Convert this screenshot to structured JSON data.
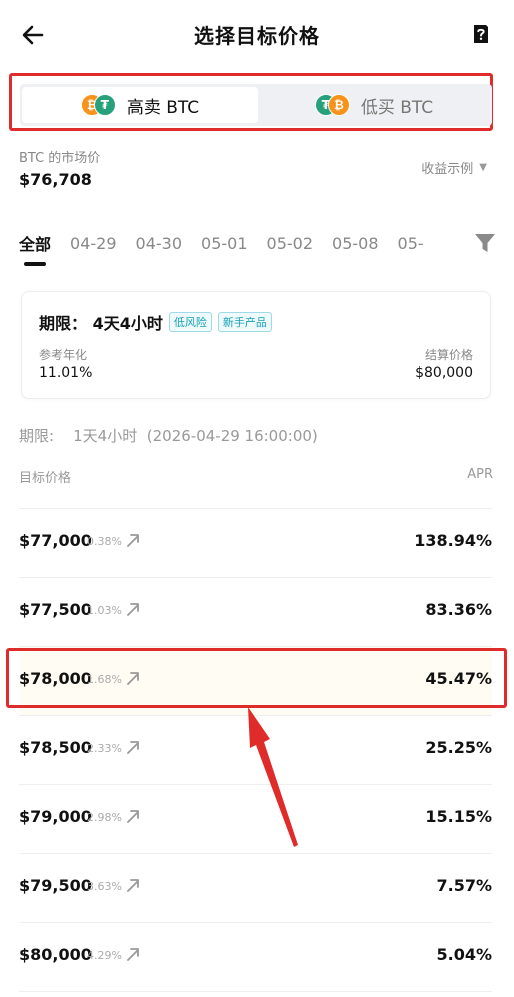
{
  "header": {
    "title": "选择目标价格",
    "back_icon": "arrow-left-icon",
    "help_icon": "help-icon"
  },
  "toggle": {
    "sell": {
      "label": "高卖 BTC",
      "coin_front": "₿",
      "coin_back": "₮"
    },
    "buy": {
      "label": "低买 BTC",
      "coin_front": "₮",
      "coin_back": "₿"
    }
  },
  "colors": {
    "btc": "#f7931a",
    "usdt": "#26a17b",
    "accent_tag": "#18a0b8",
    "annotation": "#e02b2b",
    "highlight_bg": "#fffdf3"
  },
  "market": {
    "label": "BTC 的市场价",
    "price": "$76,708",
    "example_label": "收益示例",
    "example_caret": "▼"
  },
  "tabs": [
    "全部",
    "04-29",
    "04-30",
    "05-01",
    "05-02",
    "05-08",
    "05-"
  ],
  "filter_icon": "filter-icon",
  "card": {
    "period": "期限： 4天4小时",
    "tags": [
      "低风险",
      "新手产品"
    ],
    "annual_label": "参考年化",
    "annual_value": "11.01%",
    "settle_label": "结算价格",
    "settle_value": "$80,000"
  },
  "list": {
    "period_line": "期限:    1天4小时  (2026-04-29 16:00:00)",
    "col_left": "目标价格",
    "col_right": "APR",
    "rows": [
      {
        "price": "$77,000",
        "pct": "0.38%",
        "apr": "138.94%"
      },
      {
        "price": "$77,500",
        "pct": "1.03%",
        "apr": "83.36%"
      },
      {
        "price": "$78,000",
        "pct": "1.68%",
        "apr": "45.47%"
      },
      {
        "price": "$78,500",
        "pct": "2.33%",
        "apr": "25.25%"
      },
      {
        "price": "$79,000",
        "pct": "2.98%",
        "apr": "15.15%"
      },
      {
        "price": "$79,500",
        "pct": "3.63%",
        "apr": "7.57%"
      },
      {
        "price": "$80,000",
        "pct": "4.29%",
        "apr": "5.04%"
      }
    ]
  }
}
